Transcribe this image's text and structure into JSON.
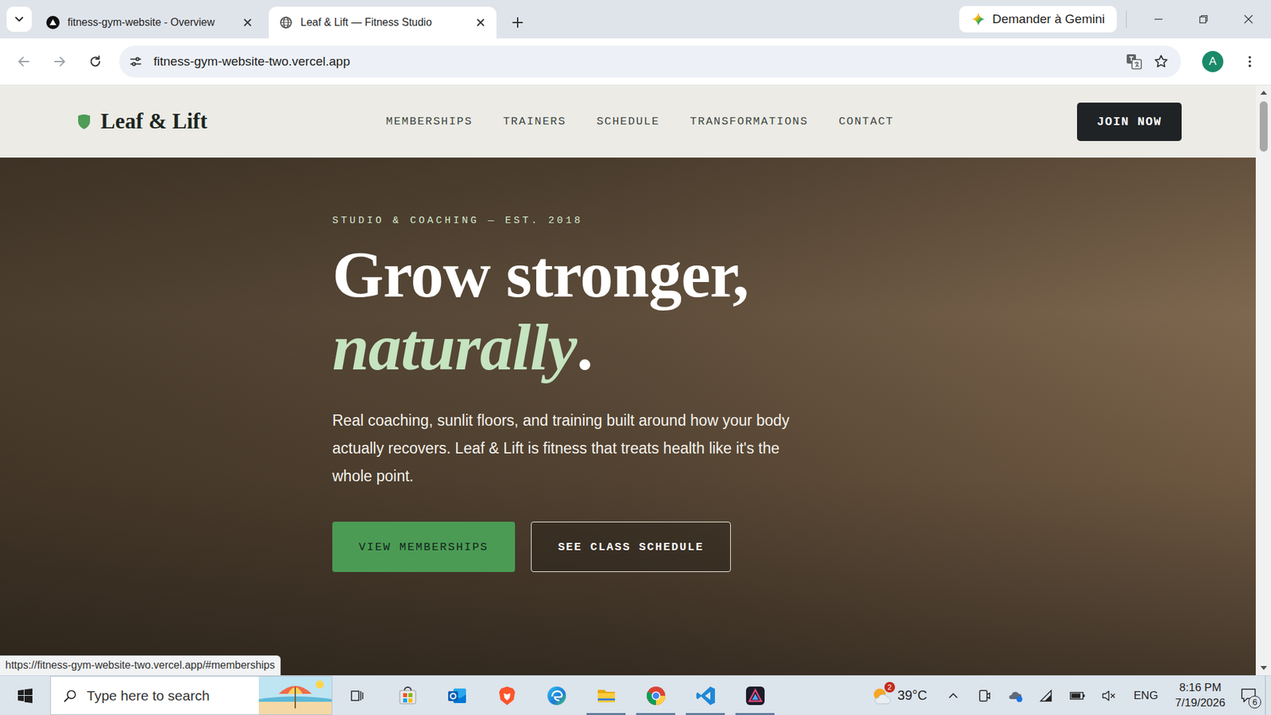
{
  "browser": {
    "tabs": [
      {
        "label": "fitness-gym-website - Overview",
        "selected": false,
        "kind": "vercel"
      },
      {
        "label": "Leaf & Lift — Fitness Studio",
        "selected": true,
        "kind": "globe"
      }
    ],
    "gemini_button": "Demander à Gemini",
    "address": "fitness-gym-website-two.vercel.app",
    "profile": "A",
    "status_url": "https://fitness-gym-website-two.vercel.app/#memberships",
    "scrollbar": {
      "level": 0.09
    }
  },
  "site": {
    "brand": "Leaf & Lift",
    "nav": [
      "MEMBERSHIPS",
      "TRAINERS",
      "SCHEDULE",
      "TRANSFORMATIONS",
      "CONTACT"
    ],
    "cta": "JOIN NOW",
    "hero": {
      "eyebrow": "STUDIO & COACHING — EST. 2018",
      "title": "Grow stronger,",
      "accent": "naturally",
      "accent_end": ".",
      "text": "Real coaching, sunlit floors, and training built around how your body actually recovers. Leaf & Lift is fitness that treats health like it's the whole point.",
      "buttons": [
        {
          "label": "VIEW MEMBERSHIPS",
          "kind": "primary"
        },
        {
          "label": "SEE CLASS SCHEDULE",
          "kind": "outline"
        }
      ]
    }
  },
  "taskbar": {
    "search_placeholder": "Type here to search",
    "apps": [
      {
        "kind": "store",
        "running": false
      },
      {
        "kind": "outlook",
        "running": false
      },
      {
        "kind": "brave",
        "running": false
      },
      {
        "kind": "edge",
        "running": false
      },
      {
        "kind": "explorer",
        "running": true
      },
      {
        "kind": "chrome",
        "running": true
      },
      {
        "kind": "vscode",
        "running": true
      },
      {
        "kind": "affinity",
        "running": true
      }
    ],
    "weather": {
      "badge": "2",
      "temperature": "39°C"
    },
    "tray": {
      "muted": true,
      "battery_level": 0.85
    },
    "language": "ENG",
    "time": "8:16 PM",
    "date": "7/19/2026",
    "notifications": "6"
  }
}
